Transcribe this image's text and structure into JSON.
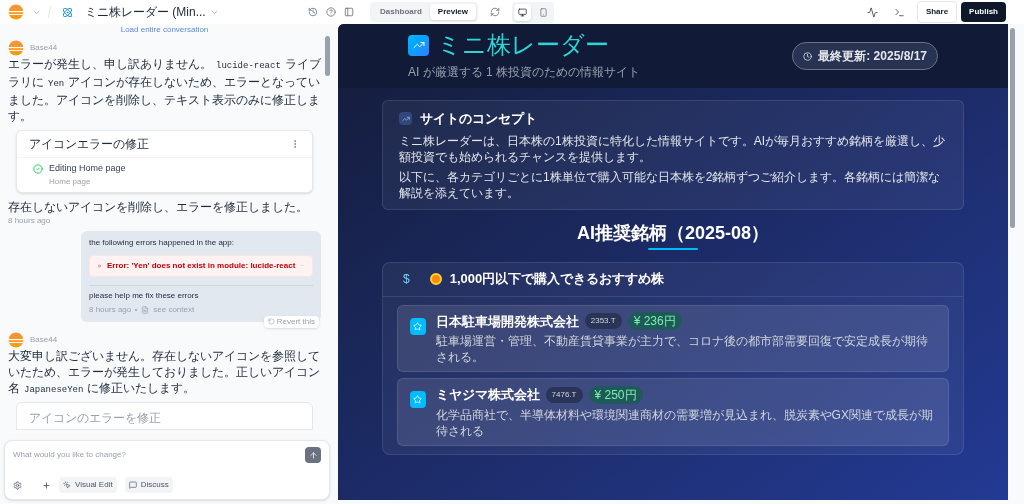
{
  "app_bar": {
    "project_name": "ミニ株レーダー (Min...",
    "tabs": [
      {
        "label": "Dashboard",
        "selected": false
      },
      {
        "label": "Preview",
        "selected": true
      }
    ],
    "devices": [
      {
        "kind": "desktop",
        "selected": true
      },
      {
        "kind": "mobile",
        "selected": false
      }
    ],
    "share": "Share",
    "publish": "Publish"
  },
  "chat": {
    "load_link": "Load entire conversation",
    "messages": [
      {
        "kind": "assistant",
        "sender": "Base44",
        "parts": [
          {
            "kind": "text",
            "text": "エラーが発生し、申し訳ありません。"
          },
          {
            "kind": "code",
            "text": "lucide-react"
          },
          {
            "kind": "text",
            "text": "ライブラリに"
          },
          {
            "kind": "code",
            "text": "Yen"
          },
          {
            "kind": "text",
            "text": "アイコンが存在しないため、エラーとなっていました。アイコンを削除し、テキスト表示のみに修正します。"
          }
        ],
        "task": {
          "title": "アイコンエラーの修正",
          "step": "Editing Home page",
          "step_sub": "Home page",
          "done": true,
          "faded": false
        },
        "after": "存在しないアイコンを削除し、エラーを修正しました。",
        "time": "8 hours ago"
      },
      {
        "kind": "user",
        "intro": "the following errors happened in the app:",
        "error": "Error: 'Yen' does not exist in module: lucide-react",
        "text": "please help me fix these errors",
        "time": "8 hours ago",
        "context": "see context",
        "revert": "Revert this"
      },
      {
        "kind": "assistant",
        "sender": "Base44",
        "parts": [
          {
            "kind": "text",
            "text": "大変申し訳ございません。存在しないアイコンを参照していたため、エラーが発生しておりました。正しいアイコン名"
          },
          {
            "kind": "code",
            "text": "JapaneseYen"
          },
          {
            "kind": "text",
            "text": "に修正いたします。"
          }
        ],
        "task": {
          "title": "アイコンのエラーを修正",
          "faded": true
        }
      }
    ],
    "composer": {
      "placeholder": "What would you like to change?",
      "visual_edit": "Visual Edit",
      "discuss": "Discuss"
    }
  },
  "preview": {
    "title": "ミニ株レーダー",
    "subtitle": "AI が厳選する 1 株投資のための情報サイト",
    "updated": "最終更新: 2025/8/17",
    "concept": {
      "title": "サイトのコンセプト",
      "paragraphs": [
        "ミニ株レーダーは、日本株の1株投資に特化した情報サイトです。AIが毎月おすすめ銘柄を厳選し、少額投資でも始められるチャンスを提供します。",
        "以下に、各カテゴリごとに1株単位で購入可能な日本株を2銘柄ずつご紹介します。各銘柄には簡潔な解説を添えています。"
      ]
    },
    "section_title": "AI推奨銘柄（2025-08）",
    "category": {
      "icon_text": "$",
      "title": "1,000円以下で購入できるおすすめ株",
      "stocks": [
        {
          "name": "日本駐車場開発株式会社",
          "code": "2353.T",
          "price": "¥ 236円",
          "description": "駐車場運営・管理、不動産賃貸事業が主力で、コロナ後の都市部需要回復で安定成長が期待される。"
        },
        {
          "name": "ミヤジマ株式会社",
          "code": "7476.T",
          "price": "¥ 250円",
          "description": "化学品商社で、半導体材料や環境関連商材の需要増が見込まれ、脱炭素やGX関連で成長が期待される"
        }
      ]
    }
  }
}
